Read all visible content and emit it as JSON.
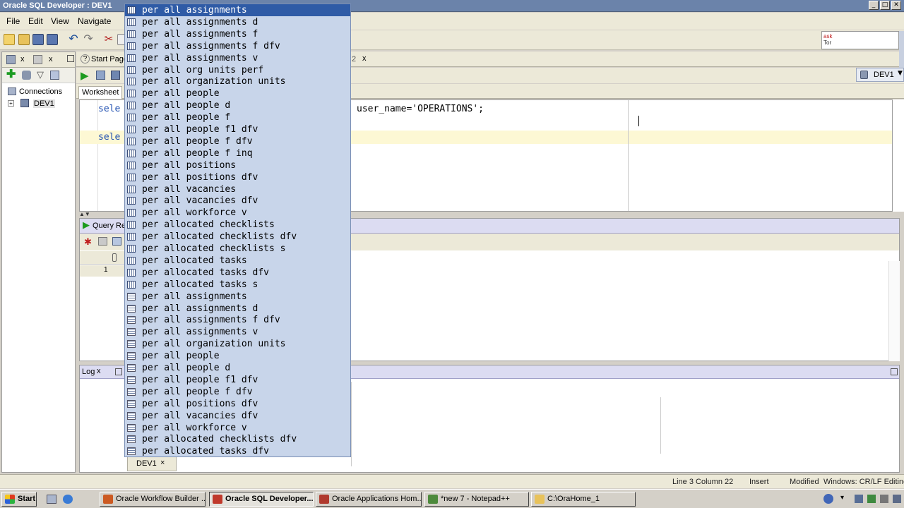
{
  "window": {
    "title": "Oracle SQL Developer : DEV1"
  },
  "menu": {
    "file": "File",
    "edit": "Edit",
    "view": "View",
    "navigate": "Navigate"
  },
  "connections": {
    "tab": "Connections",
    "node": "DEV1"
  },
  "tabs": {
    "start_page": "Start Page",
    "fragment": "2",
    "worksheet": "Worksheet",
    "query_result": "Query Re",
    "log": "Log",
    "dev1": "DEV1"
  },
  "editor": {
    "line1": "sele",
    "line1_rest": "user_name='OPERATIONS';",
    "line2": "sele"
  },
  "mini_editor": {
    "line1": "ask",
    "line2": "Tor"
  },
  "connection_select": "DEV1",
  "results": {
    "row_number": "1"
  },
  "autocomplete": {
    "items": [
      {
        "text": "per all assignments",
        "icon": "table-icon"
      },
      {
        "text": "per all assignments d",
        "icon": "table-icon"
      },
      {
        "text": "per all assignments f",
        "icon": "table-icon"
      },
      {
        "text": "per all assignments f dfv",
        "icon": "table-icon"
      },
      {
        "text": "per all assignments v",
        "icon": "table-icon"
      },
      {
        "text": "per all org units perf",
        "icon": "table-icon"
      },
      {
        "text": "per all organization units",
        "icon": "table-icon"
      },
      {
        "text": "per all people",
        "icon": "table-icon"
      },
      {
        "text": "per all people d",
        "icon": "table-icon"
      },
      {
        "text": "per all people f",
        "icon": "table-icon"
      },
      {
        "text": "per all people f1 dfv",
        "icon": "table-icon"
      },
      {
        "text": "per all people f dfv",
        "icon": "table-icon"
      },
      {
        "text": "per all people f inq",
        "icon": "table-icon"
      },
      {
        "text": "per all positions",
        "icon": "table-icon"
      },
      {
        "text": "per all positions dfv",
        "icon": "table-icon"
      },
      {
        "text": "per all vacancies",
        "icon": "table-icon"
      },
      {
        "text": "per all vacancies dfv",
        "icon": "table-icon"
      },
      {
        "text": "per all workforce v",
        "icon": "table-icon"
      },
      {
        "text": "per allocated checklists",
        "icon": "table-icon"
      },
      {
        "text": "per allocated checklists dfv",
        "icon": "table-icon"
      },
      {
        "text": "per allocated checklists s",
        "icon": "table-icon"
      },
      {
        "text": "per allocated tasks",
        "icon": "table-icon"
      },
      {
        "text": "per allocated tasks dfv",
        "icon": "table-icon"
      },
      {
        "text": "per allocated tasks s",
        "icon": "table-icon"
      },
      {
        "text": "per all assignments",
        "icon": "view-icon"
      },
      {
        "text": "per all assignments d",
        "icon": "view-icon"
      },
      {
        "text": "per all assignments f dfv",
        "icon": "view-icon"
      },
      {
        "text": "per all assignments v",
        "icon": "view-icon"
      },
      {
        "text": "per all organization units",
        "icon": "view-icon"
      },
      {
        "text": "per all people",
        "icon": "view-icon"
      },
      {
        "text": "per all people d",
        "icon": "view-icon"
      },
      {
        "text": "per all people f1 dfv",
        "icon": "view-icon"
      },
      {
        "text": "per all people f dfv",
        "icon": "view-icon"
      },
      {
        "text": "per all positions dfv",
        "icon": "view-icon"
      },
      {
        "text": "per all vacancies dfv",
        "icon": "view-icon"
      },
      {
        "text": "per all workforce v",
        "icon": "view-icon"
      },
      {
        "text": "per allocated checklists dfv",
        "icon": "view-icon"
      },
      {
        "text": "per allocated tasks dfv",
        "icon": "view-icon"
      }
    ],
    "selected_index": 0
  },
  "status": {
    "position": "Line 3 Column 22",
    "mode": "Insert",
    "state": "Modified",
    "line_endings": "Windows: CR/LF Editing"
  },
  "taskbar": {
    "start": "Start",
    "items": [
      "Oracle Workflow Builder ...",
      "Oracle SQL Developer...",
      "Oracle Applications Hom...",
      "*new 7 - Notepad++",
      "C:\\OraHome_1"
    ],
    "active_index": 1
  },
  "colors": {
    "selection": "#2f5ba6",
    "popup_bg": "#c8d5ea",
    "current_line": "#fdf8d4",
    "titlebar": "#6b83aa"
  }
}
